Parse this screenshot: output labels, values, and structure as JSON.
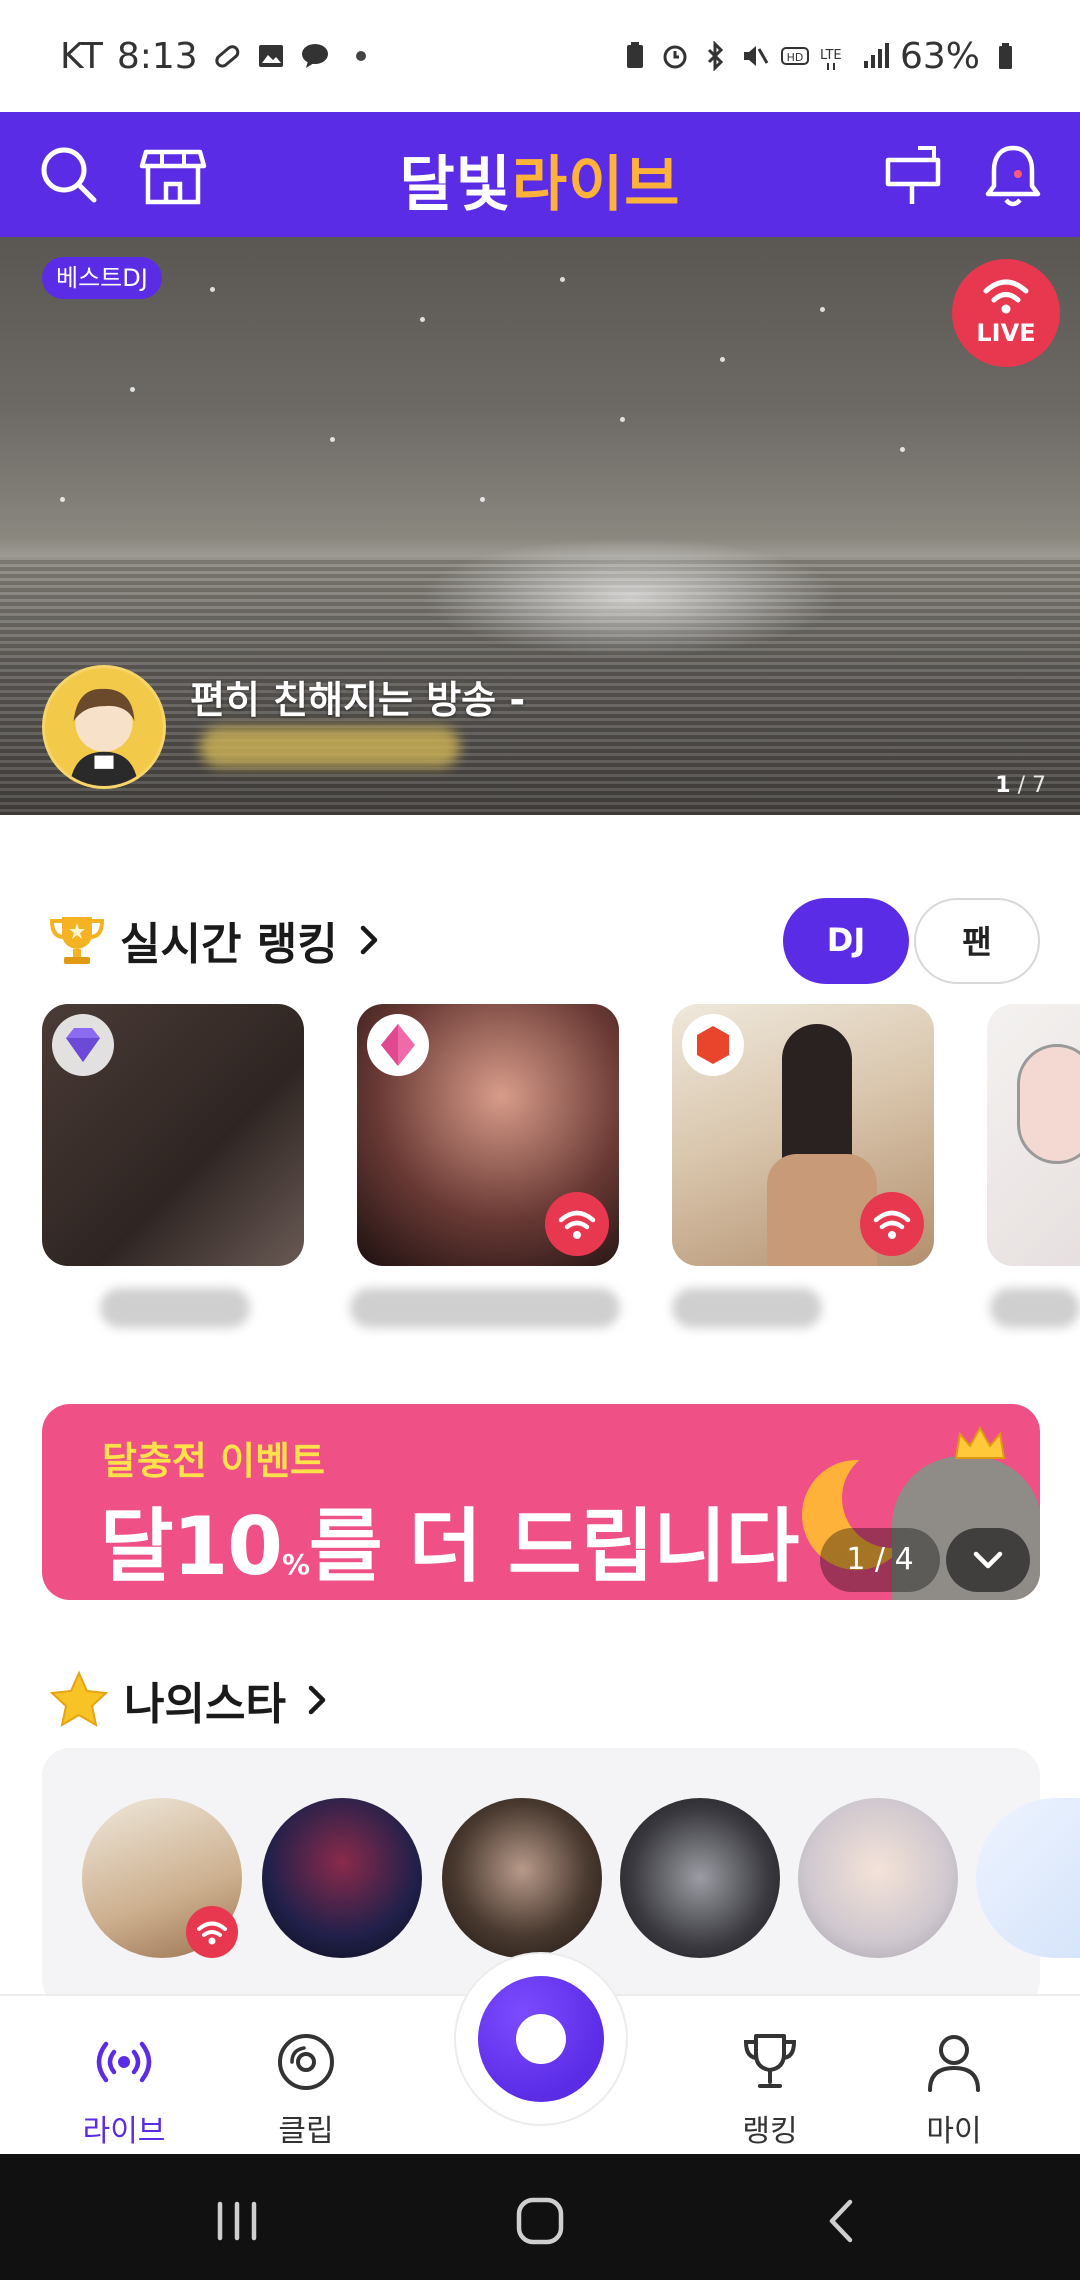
{
  "status_bar": {
    "carrier": "KT",
    "time": "8:13",
    "battery": "63%"
  },
  "top_bar": {
    "logo_white": "달빛",
    "logo_orange": "라이브"
  },
  "hero": {
    "badge": "베스트DJ",
    "live_label": "LIVE",
    "title": "편히 친해지는 방송 -",
    "page_current": "1",
    "page_total": "/ 7"
  },
  "ranking": {
    "title": "실시간 랭킹",
    "tab_dj": "DJ",
    "tab_fan": "팬"
  },
  "event_banner": {
    "small_text": "달충전 이벤트",
    "big_text": "달10",
    "big_unit": "%",
    "big_tail": "를 더 드립니다",
    "pager": "1 / 4"
  },
  "my_stars": {
    "title": "나의스타"
  },
  "bottom_nav": {
    "live": "라이브",
    "clip": "클립",
    "ranking": "랭킹",
    "my": "마이"
  },
  "colors": {
    "brand": "#5b2ce6",
    "accent": "#ffb23a",
    "live": "#e8384f",
    "event": "#ef5086"
  },
  "icons": [
    "search-icon",
    "store-icon",
    "mailbox-icon",
    "bell-icon",
    "trophy-icon",
    "star-icon",
    "chevron-right-icon",
    "broadcast-icon",
    "clip-icon",
    "person-icon"
  ]
}
